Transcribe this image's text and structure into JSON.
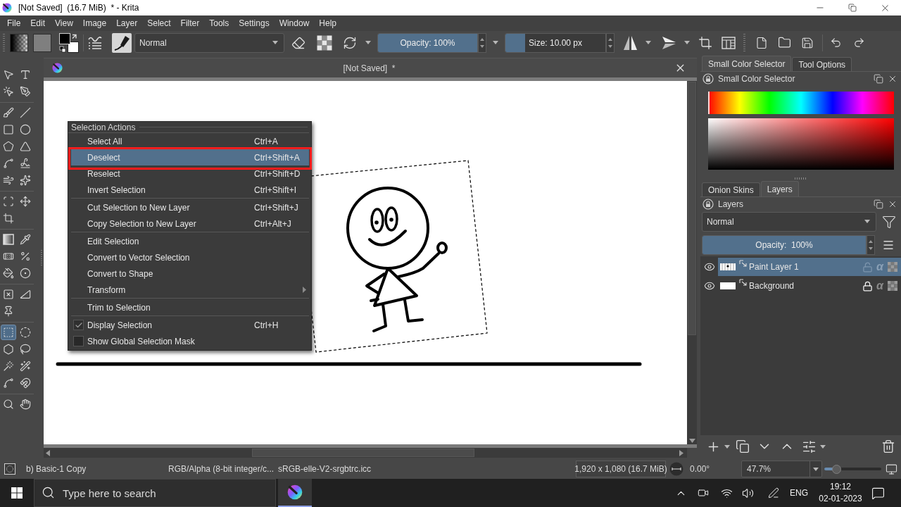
{
  "window": {
    "title": "[Not Saved]  (16.7 MiB)  * - Krita"
  },
  "menu_bar": [
    "File",
    "Edit",
    "View",
    "Image",
    "Layer",
    "Select",
    "Filter",
    "Tools",
    "Settings",
    "Window",
    "Help"
  ],
  "tool_options_bar": {
    "blend_mode": "Normal",
    "opacity": {
      "label": "Opacity: 100%",
      "level": 1
    },
    "size": {
      "label": "Size: 10.00 px",
      "level": 0.2
    }
  },
  "toolbox": {
    "groups": [
      [
        {
          "kind": "pointer",
          "selected": false
        },
        {
          "kind": "text",
          "selected": false
        },
        {
          "kind": "shapeedit",
          "selected": false
        },
        {
          "kind": "calligraphy",
          "selected": false
        }
      ],
      [
        {
          "kind": "brush",
          "selected": false
        },
        {
          "kind": "line",
          "selected": false
        },
        {
          "kind": "rectangle",
          "selected": false
        },
        {
          "kind": "ellipse",
          "selected": false
        },
        {
          "kind": "polygon",
          "selected": false
        },
        {
          "kind": "polyline",
          "selected": false
        },
        {
          "kind": "bezier",
          "selected": false
        },
        {
          "kind": "freehand",
          "selected": false
        },
        {
          "kind": "dynamic",
          "selected": false
        },
        {
          "kind": "multibrush",
          "selected": false
        }
      ],
      [
        {
          "kind": "transform",
          "selected": false
        },
        {
          "kind": "move",
          "selected": false
        },
        {
          "kind": "crop",
          "selected": false
        }
      ],
      [
        {
          "kind": "gradient",
          "selected": false
        },
        {
          "kind": "picker",
          "selected": false
        },
        {
          "kind": "patch",
          "selected": false
        },
        {
          "kind": "colorize",
          "selected": false
        },
        {
          "kind": "fill",
          "selected": false
        },
        {
          "kind": "enclose",
          "selected": false
        }
      ],
      [
        {
          "kind": "assistant",
          "selected": false
        },
        {
          "kind": "measure",
          "selected": false
        },
        {
          "kind": "reference",
          "selected": false
        }
      ],
      [
        {
          "kind": "rectselect",
          "selected": true
        },
        {
          "kind": "ellipseselect",
          "selected": false
        },
        {
          "kind": "polyselect",
          "selected": false
        },
        {
          "kind": "lassoselect",
          "selected": false
        },
        {
          "kind": "contiguousselect",
          "selected": false
        },
        {
          "kind": "similarselect",
          "selected": false
        },
        {
          "kind": "bezierselect",
          "selected": false
        },
        {
          "kind": "magneticselect",
          "selected": false
        }
      ],
      [
        {
          "kind": "zoom",
          "selected": false
        },
        {
          "kind": "pan",
          "selected": false
        }
      ]
    ]
  },
  "document": {
    "title": "[Not Saved]  *",
    "context_menu": {
      "title": "Selection Actions",
      "groups": [
        [
          {
            "label": "Select All",
            "shortcut": "Ctrl+A",
            "kind": "action",
            "selected": false,
            "annotated": false
          },
          {
            "label": "Deselect",
            "shortcut": "Ctrl+Shift+A",
            "kind": "action",
            "selected": true,
            "annotated": true
          },
          {
            "label": "Reselect",
            "shortcut": "Ctrl+Shift+D",
            "kind": "action",
            "selected": false,
            "annotated": false
          },
          {
            "label": "Invert Selection",
            "shortcut": "Ctrl+Shift+I",
            "kind": "action",
            "selected": false,
            "annotated": false
          }
        ],
        [
          {
            "label": "Cut Selection to New Layer",
            "shortcut": "Ctrl+Shift+J",
            "kind": "action",
            "selected": false,
            "annotated": false
          },
          {
            "label": "Copy Selection to New Layer",
            "shortcut": "Ctrl+Alt+J",
            "kind": "action",
            "selected": false,
            "annotated": false
          }
        ],
        [
          {
            "label": "Edit Selection",
            "kind": "action",
            "selected": false,
            "annotated": false
          },
          {
            "label": "Convert to Vector Selection",
            "kind": "action",
            "selected": false,
            "annotated": false
          },
          {
            "label": "Convert to Shape",
            "kind": "action",
            "selected": false,
            "annotated": false
          },
          {
            "label": "Transform",
            "kind": "submenu",
            "selected": false,
            "annotated": false
          }
        ],
        [
          {
            "label": "Trim to Selection",
            "kind": "action",
            "selected": false,
            "annotated": false
          }
        ],
        [
          {
            "label": "Display Selection",
            "shortcut": "Ctrl+H",
            "kind": "checkbox",
            "checked": true,
            "selected": false,
            "annotated": false
          },
          {
            "label": "Show Global Selection Mask",
            "kind": "checkbox",
            "checked": false,
            "selected": false,
            "annotated": false
          }
        ]
      ]
    }
  },
  "dockers": {
    "color_selector": {
      "tabs": [
        {
          "label": "Small Color Selector",
          "selected": true
        },
        {
          "label": "Tool Options",
          "selected": false
        }
      ],
      "title": "Small Color Selector",
      "hue_slider": {
        "level": 0
      }
    },
    "layers": {
      "tabs": [
        {
          "label": "Onion Skins",
          "selected": false
        },
        {
          "label": "Layers",
          "selected": true
        }
      ],
      "title": "Layers",
      "blend_mode": "Normal",
      "opacity": {
        "label": "Opacity:  100%",
        "level": 1
      },
      "layers": [
        {
          "name": "Paint Layer 1",
          "kind": "transparent",
          "selected": true,
          "visible": true,
          "locked": false,
          "alpha_icon": "α"
        },
        {
          "name": "Background",
          "kind": "opaque",
          "selected": false,
          "visible": true,
          "locked": true,
          "alpha_icon": "α"
        }
      ]
    }
  },
  "status_bar": {
    "brush": "b) Basic-1 Copy",
    "color_model": "RGB/Alpha (8-bit integer/c...",
    "profile": "sRGB-elle-V2-srgbtrc.icc",
    "dimensions": "1,920 x 1,080 (16.7 MiB)",
    "rotation": "0.00°",
    "zoom": "47.7%",
    "zoom_slider": {
      "level": 0.22
    }
  },
  "taskbar": {
    "search": {
      "placeholder": "Type here to search"
    },
    "language": "ENG",
    "time": "19:12",
    "date": "02-01-2023"
  }
}
